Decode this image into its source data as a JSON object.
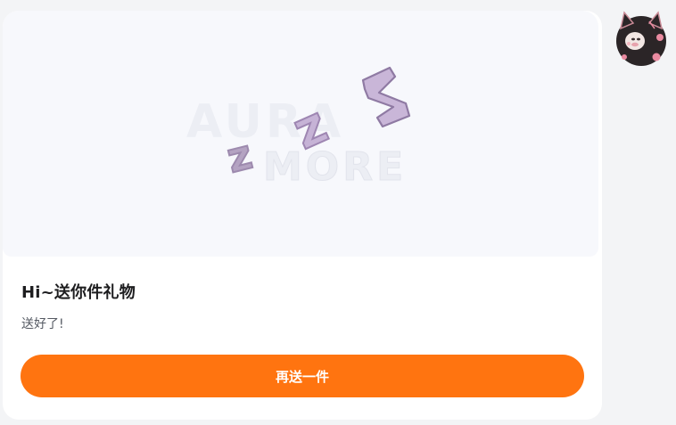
{
  "message": {
    "banner": {
      "watermark_top": "AURA",
      "watermark_bottom": "MORE",
      "sleep_letters": [
        "z",
        "z",
        "z"
      ],
      "sleep_color": "#c3b0d3"
    },
    "title": "Hi~送你件礼物",
    "subtitle": "送好了!",
    "button_label": "再送一件",
    "button_color": "#ff7410"
  },
  "avatar": {
    "icon": "cat-avatar-icon"
  }
}
